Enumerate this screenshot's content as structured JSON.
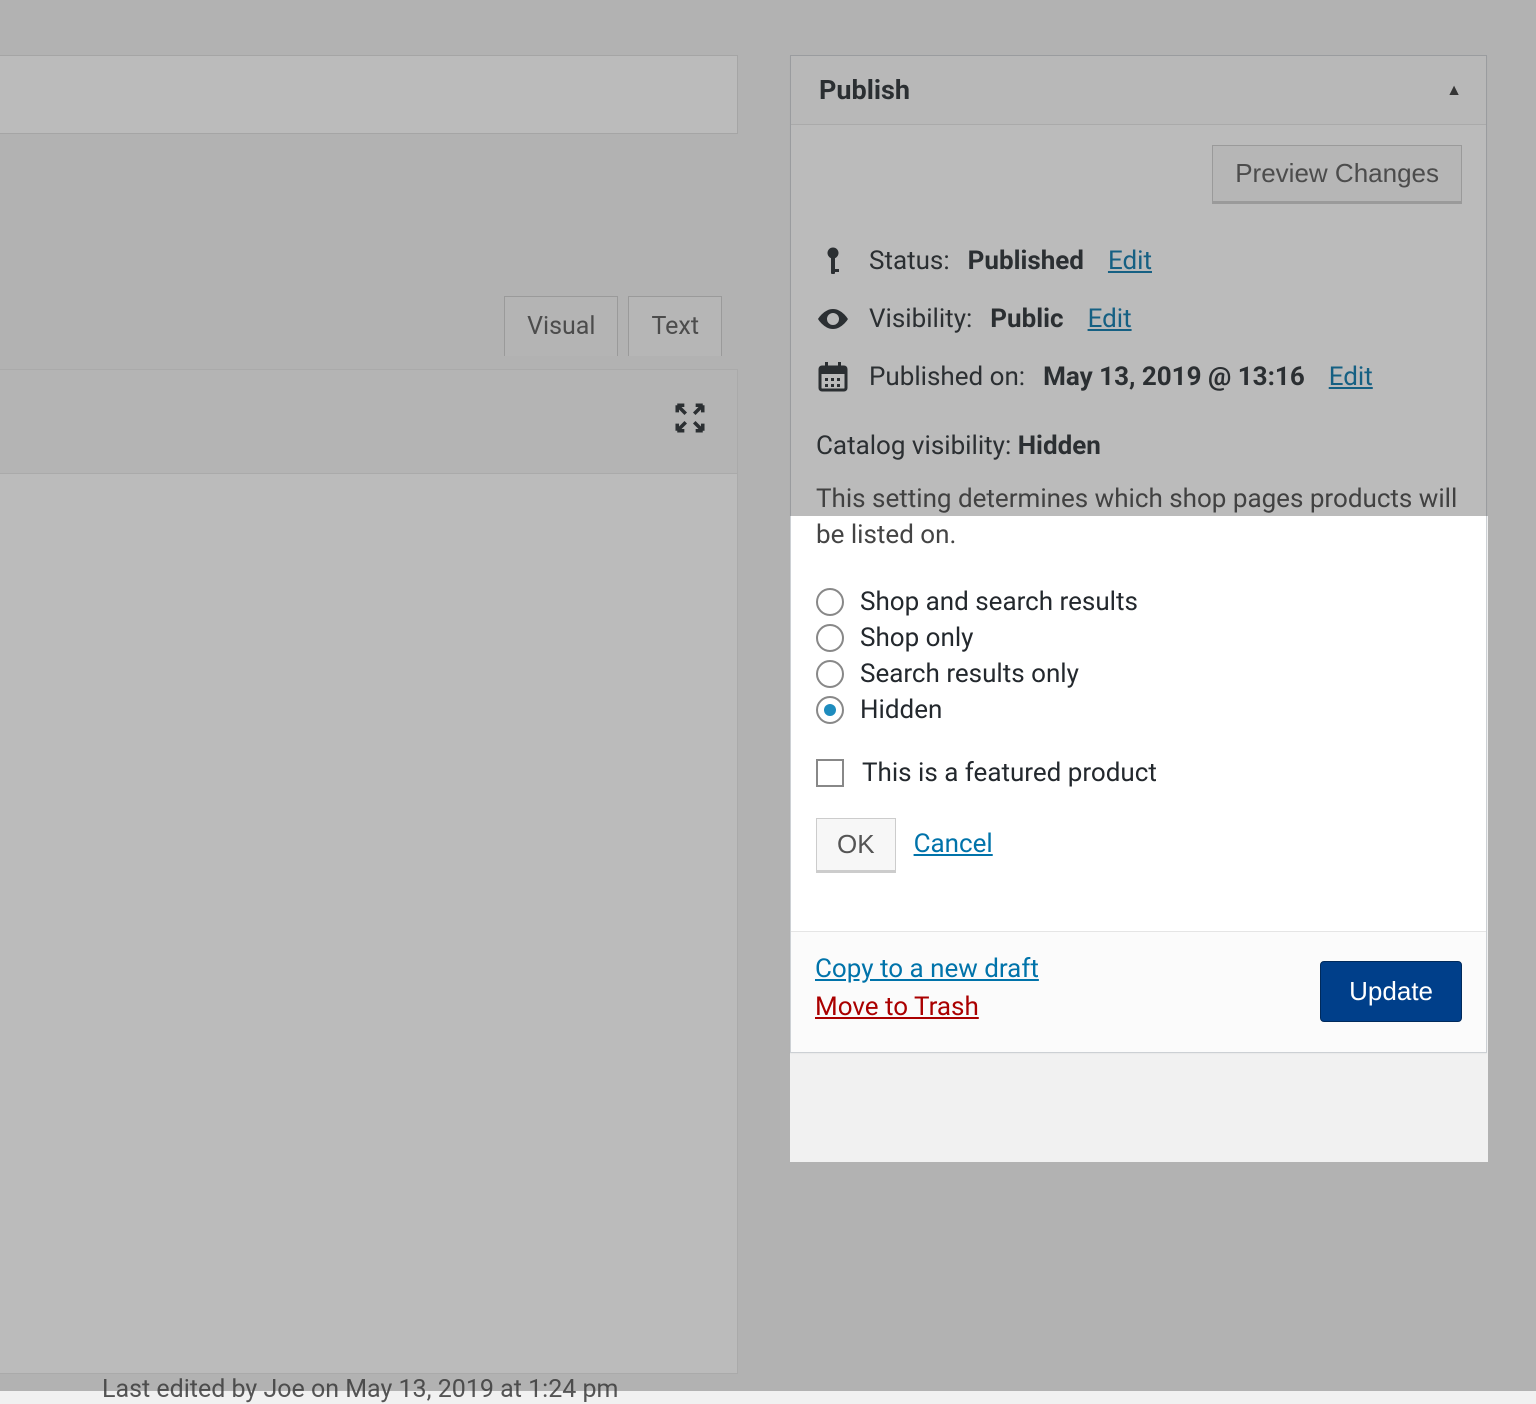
{
  "editor": {
    "tabs": {
      "visual": "Visual",
      "text": "Text"
    },
    "last_edited": "Last edited by Joe on May 13, 2019 at 1:24 pm"
  },
  "publish": {
    "title": "Publish",
    "preview_button": "Preview Changes",
    "status": {
      "label": "Status:",
      "value": "Published",
      "edit": "Edit"
    },
    "visibility": {
      "label": "Visibility:",
      "value": "Public",
      "edit": "Edit"
    },
    "published_on": {
      "label": "Published on:",
      "value": "May 13, 2019 @ 13:16",
      "edit": "Edit"
    },
    "catalog": {
      "label": "Catalog visibility:",
      "value": "Hidden",
      "description": "This setting determines which shop pages products will be listed on.",
      "options": [
        {
          "label": "Shop and search results",
          "checked": false
        },
        {
          "label": "Shop only",
          "checked": false
        },
        {
          "label": "Search results only",
          "checked": false
        },
        {
          "label": "Hidden",
          "checked": true
        }
      ],
      "featured_label": "This is a featured product",
      "featured_checked": false,
      "ok": "OK",
      "cancel": "Cancel"
    },
    "copy_draft": "Copy to a new draft",
    "move_trash": "Move to Trash",
    "update": "Update"
  }
}
